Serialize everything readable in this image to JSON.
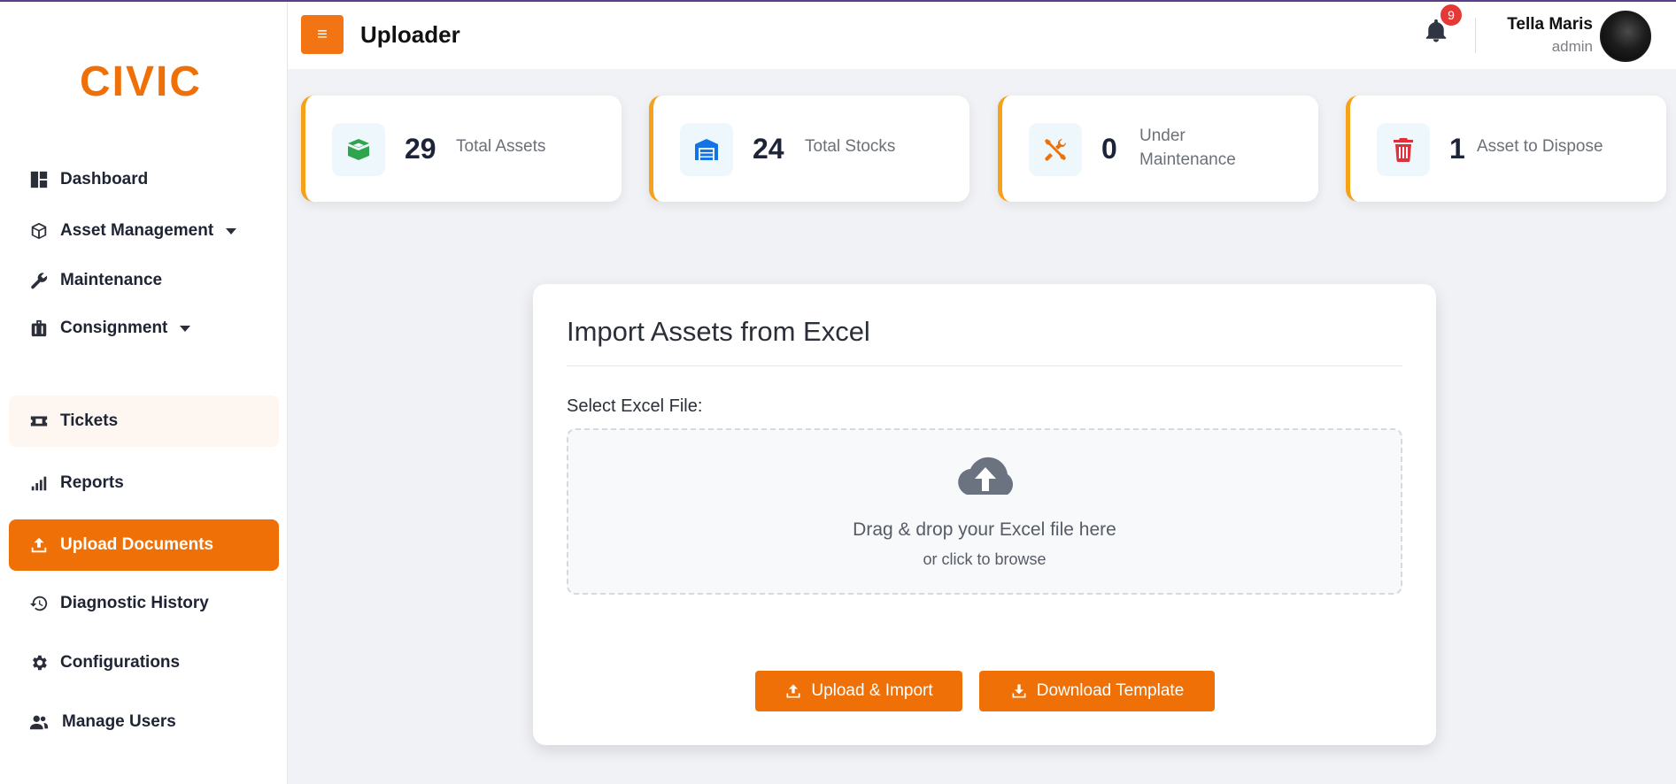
{
  "header": {
    "title": "Uploader",
    "menu_glyph": "≡",
    "notifications": "9"
  },
  "user": {
    "name": "Tella Maris",
    "role": "admin"
  },
  "brand": {
    "accent": "#f07008",
    "card_border": "#f6a11a"
  },
  "sidebar": {
    "logo_text": "CIVIC",
    "items": [
      {
        "label": "Dashboard",
        "icon": "dashboard-icon"
      },
      {
        "label": "Asset Management",
        "icon": "box-icon",
        "has_dropdown": true
      },
      {
        "label": "Maintenance",
        "icon": "wrench-icon"
      },
      {
        "label": "Consignment",
        "icon": "suitcase-icon",
        "has_dropdown": true
      },
      {
        "label": "Tickets",
        "icon": "ticket-icon"
      },
      {
        "label": "Reports",
        "icon": "signal-bars-icon"
      },
      {
        "label": "Upload Documents",
        "icon": "upload-icon",
        "active": true
      },
      {
        "label": "Diagnostic History",
        "icon": "history-icon"
      },
      {
        "label": "Configurations",
        "icon": "gear-icon"
      },
      {
        "label": "Manage Users",
        "icon": "users-icon"
      }
    ]
  },
  "stats": [
    {
      "value": "29",
      "label": "Total Assets",
      "icon": "open-box-icon",
      "color": "#2ea44f"
    },
    {
      "value": "24",
      "label": "Total Stocks",
      "icon": "warehouse-icon",
      "color": "#1473e6"
    },
    {
      "value": "0",
      "label": "Under Maintenance",
      "icon": "tools-icon",
      "color": "#f07008"
    },
    {
      "value": "1",
      "label": "Asset to Dispose",
      "icon": "trash-icon",
      "color": "#e0313a"
    }
  ],
  "import": {
    "title": "Import Assets from Excel",
    "field_label": "Select Excel File:",
    "drop_main": "Drag & drop your Excel file here",
    "drop_sub": "or click to browse",
    "upload_button": "Upload & Import",
    "template_button": "Download Template"
  }
}
